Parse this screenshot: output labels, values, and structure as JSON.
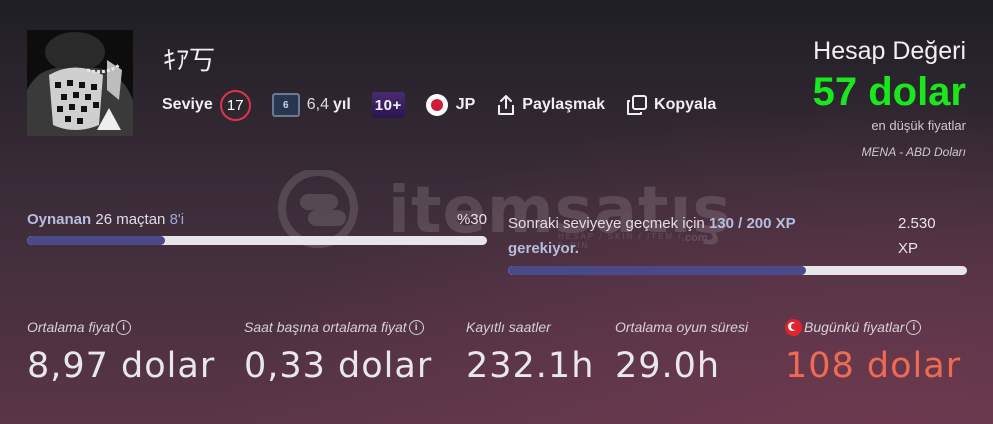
{
  "profile": {
    "username": "ｷｱ丂",
    "level_label": "Seviye",
    "level": "17",
    "years_badge": "6",
    "years_value": "6,4",
    "years_unit": "yıl",
    "rank_badge": "10+",
    "country": "JP",
    "share_label": "Paylaşmak",
    "copy_label": "Kopyala"
  },
  "account_value": {
    "title": "Hesap Değeri",
    "amount": "57 dolar",
    "note": "en düşük fiyatlar",
    "currency": "MENA - ABD Doları",
    "accent_color": "#19e81c"
  },
  "watermark": {
    "brand": "itemsatış",
    "tagline": "HESAP / SKIN / ITEM / E-PIN",
    "domain": ".com"
  },
  "played": {
    "label": "Oynanan",
    "matches_text": "26 maçtan",
    "count_text": "8'i",
    "percent_text": "%30",
    "progress": 0.3
  },
  "next_level": {
    "text_before": "Sonraki seviyeye geçmek için",
    "xp_progress": "130 / 200 XP",
    "text_after": "gerekiyor.",
    "xp_total": "2.530",
    "xp_unit": "XP",
    "progress": 0.65
  },
  "stats": [
    {
      "label": "Ortalama fiyat",
      "value": "8,97 dolar"
    },
    {
      "label": "Saat başına ortalama fiyat",
      "value": "0,33 dolar"
    },
    {
      "label": "Kayıtlı saatler",
      "value": "232.1h"
    },
    {
      "label": "Ortalama oyun süresi",
      "value": "29.0h"
    },
    {
      "label": "Bugünkü fiyatlar",
      "value": "108 dolar"
    }
  ],
  "icons": {
    "info": "i"
  }
}
